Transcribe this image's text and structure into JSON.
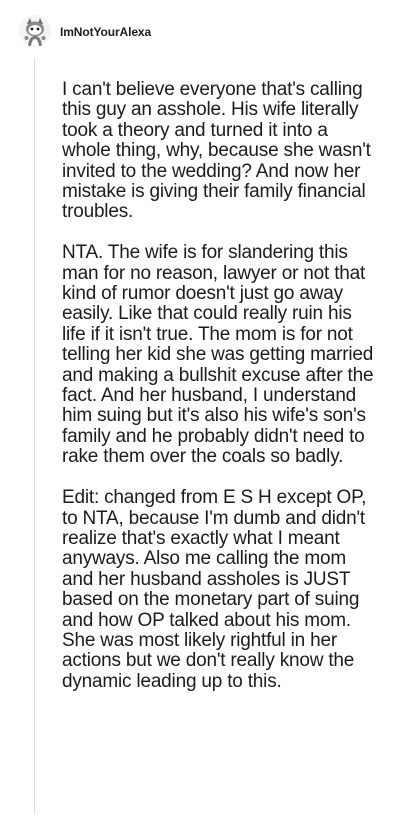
{
  "comment": {
    "author": "ImNotYourAlexa",
    "avatar_icon": "snoo-avatar-icon",
    "paragraphs": [
      "I can't believe everyone that's calling this guy an asshole. His wife literally took a theory and turned it into a whole thing, why, because she wasn't invited to the wedding? And now her mistake is giving their family financial troubles.",
      "NTA. The wife is for slandering this man for no reason, lawyer or not that kind of rumor doesn't just go away easily. Like that could really ruin his life if it isn't true. The mom is for not telling her kid she was getting married and making a bullshit excuse after the fact. And her husband, I understand him suing but it's also his wife's son's family and he probably didn't need to rake them over the coals so badly.",
      "Edit: changed from E S H except OP, to NTA, because I'm dumb and didn't realize that's exactly what I meant anyways. Also me calling the mom and her husband assholes is JUST based on the monetary part of suing and how OP talked about his mom. She was most likely rightful in her actions but we don't really know the dynamic leading up to this."
    ]
  },
  "colors": {
    "text": "#1c1c1c",
    "thread_line": "#dadada",
    "background": "#ffffff"
  }
}
